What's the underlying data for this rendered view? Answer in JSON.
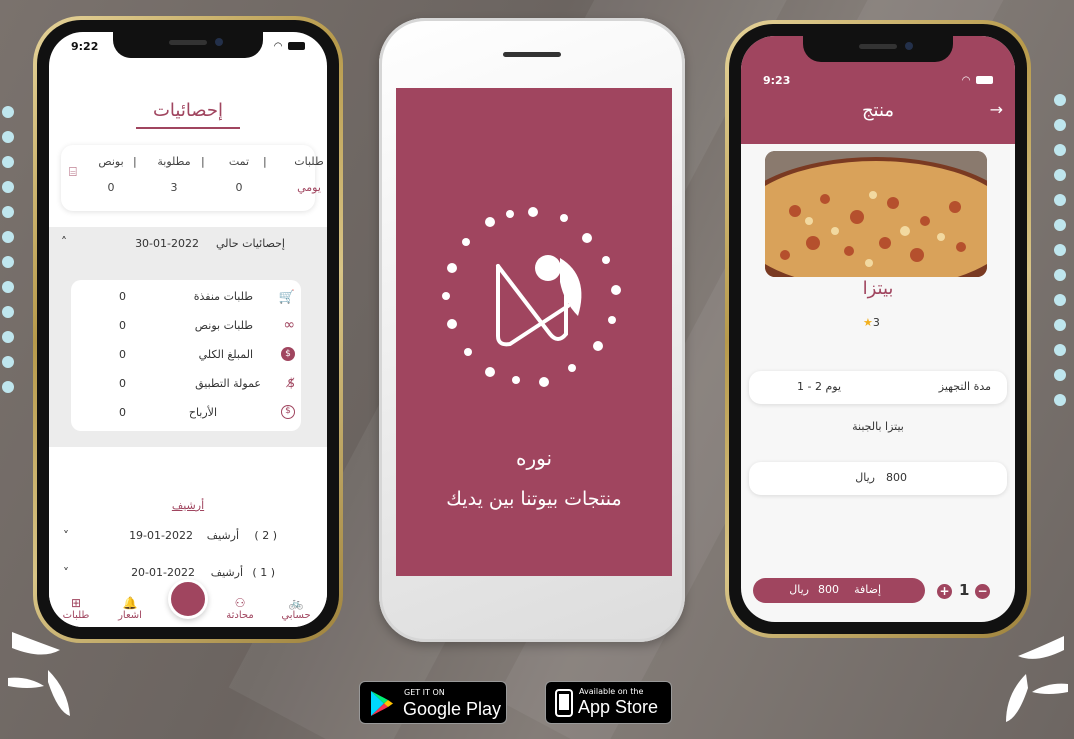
{
  "left_phone": {
    "status_time": "9:22",
    "title": "إحصائيات",
    "summary": {
      "headers": [
        "طلبات",
        "تمت",
        "مطلوبة",
        "بونص"
      ],
      "period_label": "يومي",
      "values": [
        "0",
        "3",
        "0"
      ]
    },
    "current_stats": {
      "label": "إحصائيات حالي",
      "date": "30-01-2022",
      "rows": [
        {
          "label": "طلبات منفذة",
          "value": "0"
        },
        {
          "label": "طلبات بونص",
          "value": "0"
        },
        {
          "label": "المبلغ الكلي",
          "value": "0"
        },
        {
          "label": "عمولة التطبيق",
          "value": "0"
        },
        {
          "label": "الأرباح",
          "value": "0"
        }
      ]
    },
    "archive": {
      "title": "أرشيف",
      "items": [
        {
          "count": "( 2 )",
          "label": "أرشيف",
          "date": "19-01-2022"
        },
        {
          "count": "( 1 )",
          "label": "أرشيف",
          "date": "20-01-2022"
        }
      ]
    },
    "tabs": {
      "orders": "طلبات",
      "notifications": "اشعار",
      "chat": "محادثة",
      "account": "حسابي"
    }
  },
  "middle_phone": {
    "brand_name": "نوره",
    "tagline": "منتجات بيوتنا بين يديك"
  },
  "right_phone": {
    "status_time": "9:23",
    "title": "منتج",
    "product_name": "بيتزا",
    "rating": "3",
    "prep_label": "مدة التجهيز",
    "prep_value": "1 - 2 يوم",
    "description": "بيتزا بالجبنة",
    "price": "800",
    "currency": "ريال",
    "add_label": "إضافة",
    "add_price": "800",
    "add_currency": "ريال",
    "quantity": "1"
  },
  "badges": {
    "google_small": "GET IT ON",
    "google_big": "Google Play",
    "apple_small": "Available on the",
    "apple_big": "App Store"
  },
  "colors": {
    "accent": "#a0455f",
    "background": "#7a726d",
    "dots": "#bfe6ee"
  }
}
